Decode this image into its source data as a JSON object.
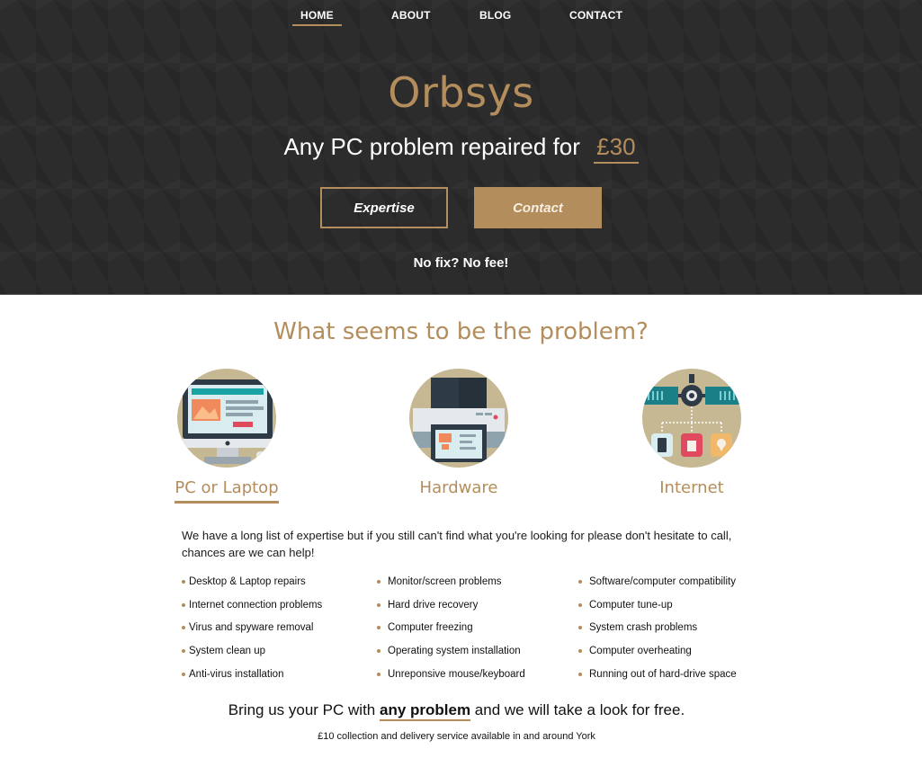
{
  "nav": {
    "items": [
      {
        "label": "HOME",
        "active": true
      },
      {
        "label": "ABOUT",
        "active": false
      },
      {
        "label": "BLOG",
        "active": false
      },
      {
        "label": "CONTACT",
        "active": false
      }
    ]
  },
  "hero": {
    "brand": "Orbsys",
    "tagline": "Any PC problem repaired for",
    "price": "£30",
    "buttons": {
      "expertise": "Expertise",
      "contact": "Contact"
    },
    "note": "No fix? No fee!"
  },
  "problems": {
    "title": "What seems to be the problem?",
    "features": [
      {
        "label": "PC or Laptop",
        "icon": "desktop-monitor-icon"
      },
      {
        "label": "Hardware",
        "icon": "printer-icon"
      },
      {
        "label": "Internet",
        "icon": "satellite-network-icon"
      }
    ],
    "intro": "We have a long list of expertise but if you still can't find what you're looking for please don't hesitate to call, chances are we can help!",
    "lists": [
      [
        "Desktop & Laptop repairs",
        "Internet connection problems",
        "Virus and spyware removal",
        "System clean up",
        "Anti-virus installation"
      ],
      [
        "Monitor/screen problems",
        "Hard drive recovery",
        "Computer freezing",
        "Operating system installation",
        "Unreponsive mouse/keyboard"
      ],
      [
        "Software/computer compatibility",
        "Computer tune-up",
        "System crash problems",
        "Computer overheating",
        "Running out of hard-drive space"
      ]
    ],
    "bring": {
      "before": "Bring us your PC with ",
      "highlight": "any problem",
      "after": " and we will take a look for free."
    },
    "delivery": "£10 collection and delivery service available in and around York"
  },
  "colors": {
    "accent": "#b38d5c",
    "hero_bg": "#2c2c2c",
    "icon_circle": "#c7b894"
  }
}
